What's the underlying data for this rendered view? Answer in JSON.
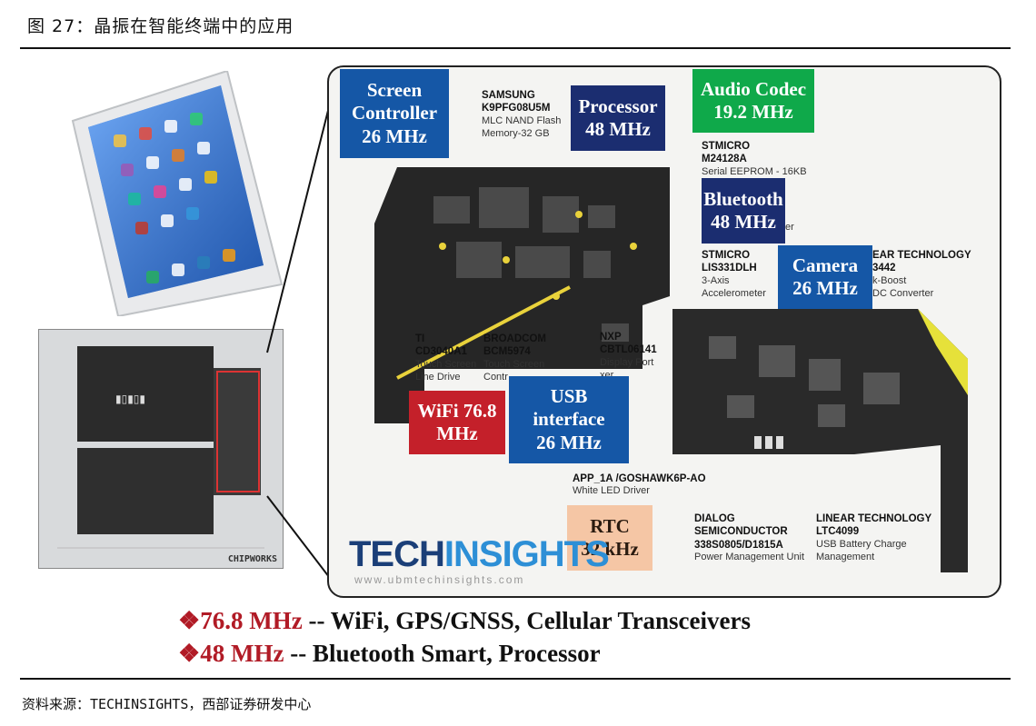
{
  "figure_title": "图 27：晶振在智能终端中的应用",
  "source": "资料来源：TECHINSIGHTS，西部证券研发中心",
  "photo_caption": "CHIPWORKS",
  "callouts": {
    "screen_controller": {
      "line1": "Screen",
      "line2": "Controller",
      "line3": "26 MHz"
    },
    "processor": {
      "line1": "Processor",
      "line2": "48 MHz"
    },
    "audio_codec": {
      "line1": "Audio Codec",
      "line2": "19.2 MHz"
    },
    "bluetooth": {
      "line1": "Bluetooth",
      "line2": "48 MHz"
    },
    "camera": {
      "line1": "Camera",
      "line2": "26 MHz"
    },
    "wifi": {
      "line1": "WiFi 76.8",
      "line2": "MHz"
    },
    "usb": {
      "line1": "USB",
      "line2": "interface",
      "line3": "26 MHz"
    },
    "rtc": {
      "line1": "RTC",
      "line2": "32 kHz"
    }
  },
  "chips": {
    "samsung": {
      "name": "SAMSUNG",
      "part": "K9PFG08U5M",
      "d1": "MLC NAND Flash",
      "d2": "Memory-32 GB"
    },
    "stmicro_eeprom": {
      "name": "STMICRO",
      "part": "M24128A",
      "d1": "Serial EEPROM - 16KB"
    },
    "stmicro_accel": {
      "name": "STMICRO",
      "part": "LIS331DLH",
      "d1": "3-Axis",
      "d2": "Accelerometer"
    },
    "linear_boost": {
      "name": "EAR TECHNOLOGY",
      "part": "3442",
      "d1": "k-Boost",
      "d2": "DC Converter"
    },
    "ti": {
      "name": "TI",
      "part": "CD3040A1",
      "d1": "Touch Screen",
      "d2": "Line Drive"
    },
    "broadcom": {
      "name": "BROADCOM",
      "part": "BCM5974",
      "d1": "Touch Screen",
      "d2": "Contr"
    },
    "nxp": {
      "name": "NXP",
      "part": "CBTL06141",
      "d1": "Display Port",
      "d2": "xer"
    },
    "led_driver": {
      "part": "APP_1A /GOSHAWK6P-AO",
      "d1": "White LED Driver"
    },
    "dialog": {
      "name": "DIALOG",
      "name2": "SEMICONDUCTOR",
      "part": "338S0805/D1815A",
      "d1": "Power Management Unit"
    },
    "linear_charge": {
      "name": "LINEAR TECHNOLOGY",
      "part": "LTC4099",
      "d1": "USB Battery Charge",
      "d2": "Management"
    },
    "bt_suffix": "er"
  },
  "logo": {
    "part1": "TECH",
    "part2": "INSIGHTS",
    "url": "www.ubmtechinsights.com"
  },
  "frequencies": [
    {
      "mark": "❖",
      "value": "76.8 MHz",
      "rest": " -- WiFi, GPS/GNSS, Cellular Transceivers"
    },
    {
      "mark": "❖",
      "value": "48 MHz",
      "rest": " -- Bluetooth Smart, Processor"
    }
  ],
  "colors": {
    "blue": "#1557a6",
    "navy": "#1b2d70",
    "green": "#0fa94a",
    "red": "#c4202a",
    "peach": "#f5c6a5",
    "accent": "#b11b26"
  }
}
